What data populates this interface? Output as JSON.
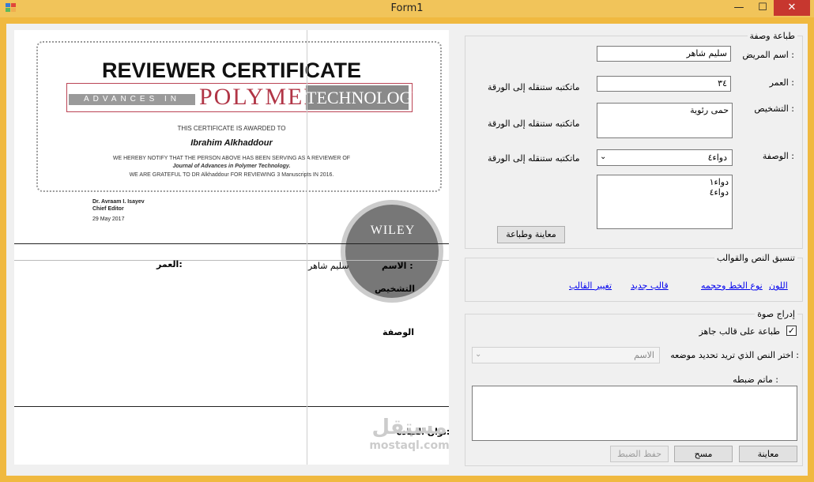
{
  "window": {
    "title": "Form1",
    "minimize": "—",
    "maximize": "☐",
    "close": "✕"
  },
  "certificate": {
    "title": "REVIEWER CERTIFICATE",
    "banner_left": "ADVANCES IN",
    "banner_mid": "POLYMER",
    "banner_right": "TECHNOLOGY",
    "awarded_to": "THIS CERTIFICATE IS AWARDED TO",
    "name": "Ibrahim Alkhaddour",
    "notify": "WE HEREBY NOTIFY THAT THE PERSON ABOVE HAS BEEN SERVING AS A REVIEWER OF",
    "journal": "Journal of Advances in Polymer Technology.",
    "grateful": "WE ARE GRATEFUL TO DR Alkhaddour FOR REVIEWING 3 Manuscripts IN 2016.",
    "signer": "Dr. Avraam I. Isayev",
    "role": "Chief Editor",
    "date": "29 May 2017",
    "publisher": "WILEY"
  },
  "prescription": {
    "name_label": "الاسم :",
    "name_value": "سليم شاهر",
    "age_label": "العمر:",
    "diagnosis_label": "التشخيص",
    "recipe_label": "الوصفة",
    "clinic_label": "نوان العيادة:"
  },
  "watermark": {
    "line1": "مستقل",
    "line2": "mostaql.com"
  },
  "print_group": {
    "legend": "طباعة وصفة",
    "patient_label": "اسم المريض :",
    "patient_value": "سليم شاهر",
    "age_label": "العمر :",
    "age_value": "٣٤",
    "age_note": "ماتكتبه ستنقله إلى الورقة",
    "diagnosis_label": "التشخيص :",
    "diagnosis_value": "حمى رئوية",
    "diagnosis_note": "ماتكتبه ستنقله إلى الورقة",
    "recipe_label": "الوصفة :",
    "recipe_combo": "دواء٤",
    "recipe_note": "ماتكتبه ستنقله إلى الورقة",
    "recipe_list": "دواء١\nدواء٤",
    "preview_print_button": "معاينة وطباعة"
  },
  "format_group": {
    "legend": "تنسيق النص والقوالب",
    "color_link": "اللون",
    "font_link": "نوع الخط وحجمه",
    "new_template_link": "قالب جديد",
    "change_template_link": "تغيير القالب"
  },
  "image_group": {
    "legend": "إدراج صوة",
    "print_template_label": "طباعة على قالب جاهز",
    "print_template_checked": true,
    "choose_text_label": "اختر النص الذي تريد تحديد موضعه :",
    "choose_text_value": "الاسم",
    "adjusted_label": "ماتم ضبطه :",
    "adjusted_value": "",
    "preview_button": "معاينة",
    "clear_button": "مسح",
    "save_button": "حفظ الضبط"
  }
}
